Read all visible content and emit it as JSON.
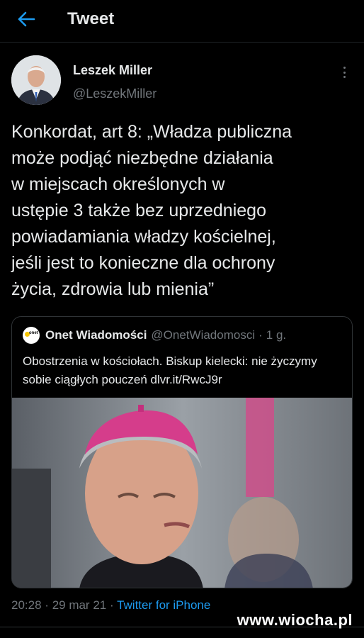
{
  "header": {
    "title": "Tweet",
    "back_icon": "arrow-left-icon",
    "accent_color": "#1d9bf0"
  },
  "tweet": {
    "author_name": "Leszek Miller",
    "author_handle": "@LeszekMiller",
    "more_icon": "more-vertical-icon",
    "text": "Konkordat, art 8: „Władza publiczna\nmoże podjąć niezbędne działania\nw miejscach określonych w\nustępie 3 także bez uprzedniego\npowiadamiania władzy kościelnej,\njeśli jest to konieczne dla ochrony\nżycia, zdrowia lub mienia”",
    "time": "20:28",
    "separator": "·",
    "date": "29 mar 21",
    "source": "Twitter for iPhone"
  },
  "quoted_tweet": {
    "avatar_label": "onet",
    "name": "Onet Wiadomości",
    "handle": "@OnetWiadomosci",
    "separator": "·",
    "time": "1 g.",
    "text": "Obostrzenia w kościołach. Biskup kielecki: nie życzymy sobie ciągłych pouczeń dlvr.it/RwcJ9r"
  },
  "watermark": "www.wiocha.pl"
}
